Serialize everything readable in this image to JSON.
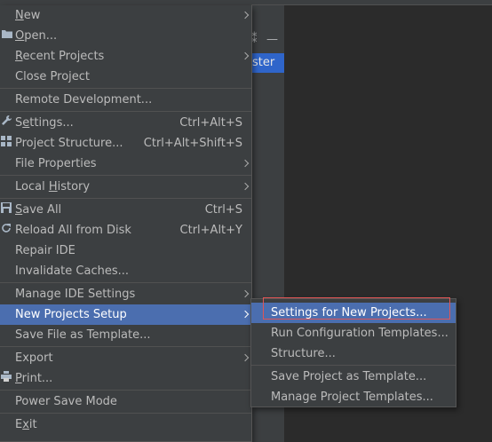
{
  "background": {
    "tool_icon_1": "⁑",
    "tool_icon_2": "—",
    "branch_text": "ster"
  },
  "file_menu": {
    "items": [
      {
        "label": "New",
        "mnemonic_index": 0,
        "submenu": true
      },
      {
        "label": "Open...",
        "mnemonic_index": 0,
        "icon": "folder-icon"
      },
      {
        "label": "Recent Projects",
        "mnemonic_index": 0,
        "submenu": true
      },
      {
        "label": "Close Project"
      },
      {
        "label": "Remote Development..."
      },
      {
        "label": "Settings...",
        "shortcut": "Ctrl+Alt+S",
        "icon": "wrench-icon"
      },
      {
        "label": "Project Structure...",
        "shortcut": "Ctrl+Alt+Shift+S",
        "icon": "project-structure-icon"
      },
      {
        "label": "File Properties",
        "submenu": true
      },
      {
        "label": "Local History",
        "submenu": true
      },
      {
        "label": "Save All",
        "shortcut": "Ctrl+S",
        "icon": "save-icon"
      },
      {
        "label": "Reload All from Disk",
        "shortcut": "Ctrl+Alt+Y",
        "icon": "reload-icon"
      },
      {
        "label": "Repair IDE"
      },
      {
        "label": "Invalidate Caches..."
      },
      {
        "label": "Manage IDE Settings",
        "submenu": true
      },
      {
        "label": "New Projects Setup",
        "submenu": true,
        "highlighted": true
      },
      {
        "label": "Save File as Template..."
      },
      {
        "label": "Export",
        "submenu": true
      },
      {
        "label": "Print...",
        "icon": "print-icon"
      },
      {
        "label": "Power Save Mode"
      },
      {
        "label": "Exit"
      }
    ]
  },
  "submenu": {
    "items": [
      {
        "label": "Settings for New Projects...",
        "highlighted": true
      },
      {
        "label": "Run Configuration Templates..."
      },
      {
        "label": "Structure..."
      },
      {
        "label": "Save Project as Template..."
      },
      {
        "label": "Manage Project Templates..."
      }
    ]
  },
  "colors": {
    "menu_bg": "#3c3f41",
    "highlight": "#4b6eaf",
    "focus_outline": "#e05555",
    "editor_bg": "#2b2b2b"
  }
}
